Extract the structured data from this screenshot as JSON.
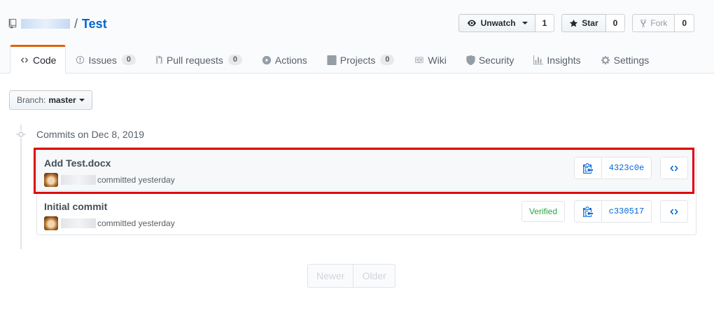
{
  "repo": {
    "separator": "/",
    "name": "Test"
  },
  "actions": {
    "watch": {
      "label": "Unwatch",
      "count": "1"
    },
    "star": {
      "label": "Star",
      "count": "0"
    },
    "fork": {
      "label": "Fork",
      "count": "0"
    }
  },
  "tabs": [
    {
      "label": "Code",
      "icon": "code-icon",
      "selected": true
    },
    {
      "label": "Issues",
      "icon": "issue-icon",
      "counter": "0"
    },
    {
      "label": "Pull requests",
      "icon": "pull-request-icon",
      "counter": "0"
    },
    {
      "label": "Actions",
      "icon": "play-icon"
    },
    {
      "label": "Projects",
      "icon": "project-icon",
      "counter": "0"
    },
    {
      "label": "Wiki",
      "icon": "book-icon"
    },
    {
      "label": "Security",
      "icon": "shield-icon"
    },
    {
      "label": "Insights",
      "icon": "graph-icon"
    },
    {
      "label": "Settings",
      "icon": "gear-icon"
    }
  ],
  "branch": {
    "prefix": "Branch:",
    "name": "master"
  },
  "commit_group": {
    "title": "Commits on Dec 8, 2019"
  },
  "commits": [
    {
      "message": "Add Test.docx",
      "meta": "committed yesterday",
      "sha": "4323c0e",
      "verified": ""
    },
    {
      "message": "Initial commit",
      "meta": "committed yesterday",
      "sha": "c330517",
      "verified": "Verified"
    }
  ],
  "pagination": {
    "newer": "Newer",
    "older": "Older"
  },
  "colors": {
    "accent": "#0366d6",
    "tab_selected": "#e36209",
    "highlight": "#e0000d",
    "verified": "#28a745"
  }
}
